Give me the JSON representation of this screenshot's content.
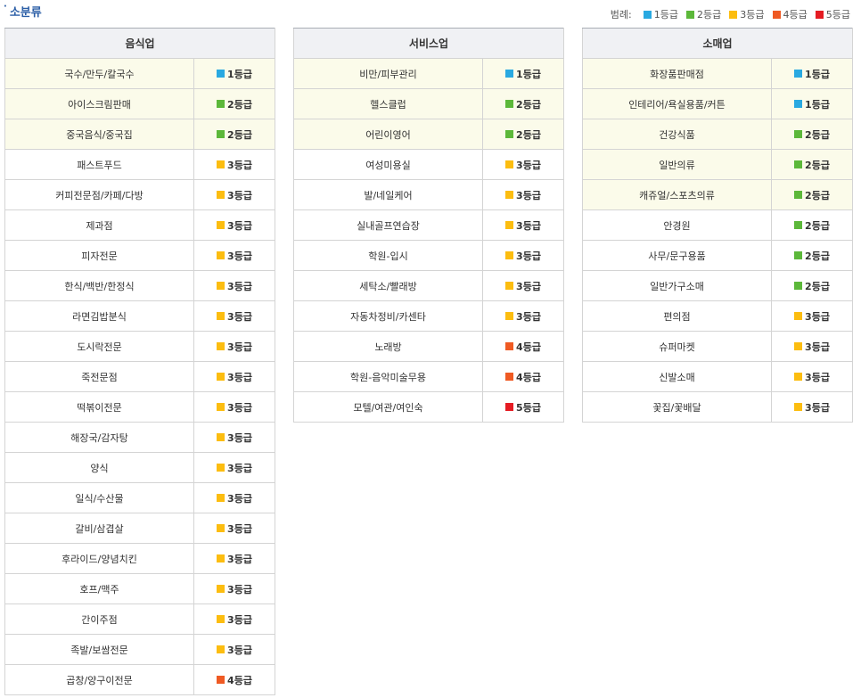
{
  "section": {
    "bullet": "·",
    "title": "소분류"
  },
  "legend": {
    "label": "범례:",
    "items": [
      {
        "label": "1등급",
        "color": "#29a9e1"
      },
      {
        "label": "2등급",
        "color": "#5cb83a"
      },
      {
        "label": "3등급",
        "color": "#fcbd10"
      },
      {
        "label": "4등급",
        "color": "#ef5a23"
      },
      {
        "label": "5등급",
        "color": "#e51c23"
      }
    ]
  },
  "grade_colors": {
    "1등급": "#29a9e1",
    "2등급": "#5cb83a",
    "3등급": "#fcbd10",
    "4등급": "#ef5a23",
    "5등급": "#e51c23"
  },
  "tables": [
    {
      "id": "t-food",
      "header": "음식업",
      "rows": [
        {
          "name": "국수/만두/칼국수",
          "grade": "1등급",
          "highlight": true
        },
        {
          "name": "아이스크림판매",
          "grade": "2등급",
          "highlight": true
        },
        {
          "name": "중국음식/중국집",
          "grade": "2등급",
          "highlight": true
        },
        {
          "name": "패스트푸드",
          "grade": "3등급",
          "highlight": false
        },
        {
          "name": "커피전문점/카페/다방",
          "grade": "3등급",
          "highlight": false
        },
        {
          "name": "제과점",
          "grade": "3등급",
          "highlight": false
        },
        {
          "name": "피자전문",
          "grade": "3등급",
          "highlight": false
        },
        {
          "name": "한식/백반/한정식",
          "grade": "3등급",
          "highlight": false
        },
        {
          "name": "라면김밥분식",
          "grade": "3등급",
          "highlight": false
        },
        {
          "name": "도시락전문",
          "grade": "3등급",
          "highlight": false
        },
        {
          "name": "죽전문점",
          "grade": "3등급",
          "highlight": false
        },
        {
          "name": "떡볶이전문",
          "grade": "3등급",
          "highlight": false
        },
        {
          "name": "해장국/감자탕",
          "grade": "3등급",
          "highlight": false
        },
        {
          "name": "양식",
          "grade": "3등급",
          "highlight": false
        },
        {
          "name": "일식/수산물",
          "grade": "3등급",
          "highlight": false
        },
        {
          "name": "갈비/삼겹살",
          "grade": "3등급",
          "highlight": false
        },
        {
          "name": "후라이드/양념치킨",
          "grade": "3등급",
          "highlight": false
        },
        {
          "name": "호프/맥주",
          "grade": "3등급",
          "highlight": false
        },
        {
          "name": "간이주점",
          "grade": "3등급",
          "highlight": false
        },
        {
          "name": "족발/보쌈전문",
          "grade": "3등급",
          "highlight": false
        },
        {
          "name": "곱창/양구이전문",
          "grade": "4등급",
          "highlight": false
        }
      ]
    },
    {
      "id": "t-service",
      "header": "서비스업",
      "rows": [
        {
          "name": "비만/피부관리",
          "grade": "1등급",
          "highlight": true
        },
        {
          "name": "헬스클럽",
          "grade": "2등급",
          "highlight": true
        },
        {
          "name": "어린이영어",
          "grade": "2등급",
          "highlight": true
        },
        {
          "name": "여성미용실",
          "grade": "3등급",
          "highlight": false
        },
        {
          "name": "발/네일케어",
          "grade": "3등급",
          "highlight": false
        },
        {
          "name": "실내골프연습장",
          "grade": "3등급",
          "highlight": false
        },
        {
          "name": "학원-입시",
          "grade": "3등급",
          "highlight": false
        },
        {
          "name": "세탁소/빨래방",
          "grade": "3등급",
          "highlight": false
        },
        {
          "name": "자동차정비/카센타",
          "grade": "3등급",
          "highlight": false
        },
        {
          "name": "노래방",
          "grade": "4등급",
          "highlight": false
        },
        {
          "name": "학원-음악미술무용",
          "grade": "4등급",
          "highlight": false
        },
        {
          "name": "모텔/여관/여인숙",
          "grade": "5등급",
          "highlight": false
        }
      ]
    },
    {
      "id": "t-retail",
      "header": "소매업",
      "rows": [
        {
          "name": "화장품판매점",
          "grade": "1등급",
          "highlight": true
        },
        {
          "name": "인테리어/욕실용품/커튼",
          "grade": "1등급",
          "highlight": true
        },
        {
          "name": "건강식품",
          "grade": "2등급",
          "highlight": true
        },
        {
          "name": "일반의류",
          "grade": "2등급",
          "highlight": true
        },
        {
          "name": "캐쥬얼/스포츠의류",
          "grade": "2등급",
          "highlight": true
        },
        {
          "name": "안경원",
          "grade": "2등급",
          "highlight": false
        },
        {
          "name": "사무/문구용품",
          "grade": "2등급",
          "highlight": false
        },
        {
          "name": "일반가구소매",
          "grade": "2등급",
          "highlight": false
        },
        {
          "name": "편의점",
          "grade": "3등급",
          "highlight": false
        },
        {
          "name": "슈퍼마켓",
          "grade": "3등급",
          "highlight": false
        },
        {
          "name": "신발소매",
          "grade": "3등급",
          "highlight": false
        },
        {
          "name": "꽃집/꽃배달",
          "grade": "3등급",
          "highlight": false
        }
      ]
    }
  ]
}
